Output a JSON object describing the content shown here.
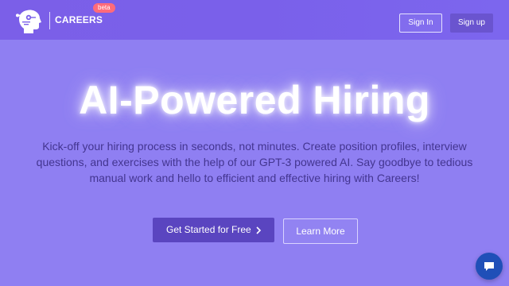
{
  "brand": {
    "name": "CAREERS",
    "badge": "beta",
    "logo_icon": "ai-head-icon"
  },
  "nav": {
    "signin_label": "Sign In",
    "signup_label": "Sign up"
  },
  "hero": {
    "title": "AI-Powered Hiring",
    "subtitle": "Kick-off your hiring process in seconds, not minutes. Create position profiles, interview questions, and exercises with the help of our GPT-3 powered AI. Say goodbye to tedious manual work and hello to efficient and effective hiring with Careers!",
    "primary_cta": "Get Started for Free",
    "primary_cta_icon": "chevron-right-icon",
    "secondary_cta": "Learn More"
  },
  "chat": {
    "icon": "chat-bubble-icon"
  },
  "colors": {
    "navbar": "#7b60ea",
    "hero_bg": "#8f7ff2",
    "primary_button": "#5a45c0",
    "signup_button": "#6a54cf",
    "beta_badge": "#ff6b7a",
    "chat_button": "#1f4fb8"
  }
}
